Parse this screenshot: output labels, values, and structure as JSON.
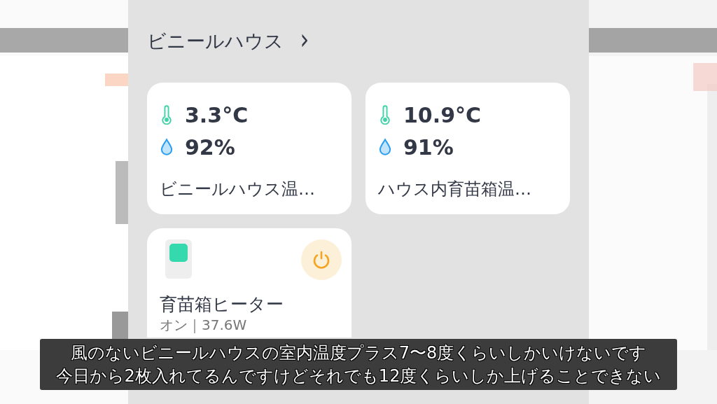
{
  "room": {
    "title": "ビニールハウス",
    "chevron": "›"
  },
  "sensors": [
    {
      "temperature": "3.3°C",
      "humidity": "92%",
      "name": "ビニールハウス温…"
    },
    {
      "temperature": "10.9°C",
      "humidity": "91%",
      "name": "ハウス内育苗箱温…"
    }
  ],
  "switches": [
    {
      "name": "育苗箱ヒーター",
      "status": "オン｜37.6W",
      "on": true
    }
  ],
  "subtitle": [
    "風のないビニールハウスの室内温度プラス7〜8度くらいしかいけないです",
    "今日から2枚入れてるんですけどそれでも12度くらいしか上げることできない"
  ]
}
